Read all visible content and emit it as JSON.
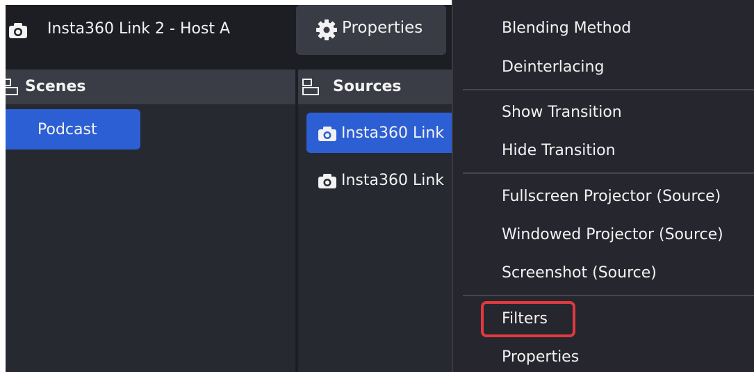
{
  "toolbar": {
    "source_title": "Insta360 Link 2 - Host A",
    "properties_label": "Properties"
  },
  "scenes": {
    "title": "Scenes",
    "items": [
      {
        "label": "Podcast",
        "selected": true
      }
    ]
  },
  "sources": {
    "title": "Sources",
    "items": [
      {
        "label": "Insta360 Link",
        "selected": true
      },
      {
        "label": "Insta360 Link",
        "selected": false
      }
    ]
  },
  "context_menu": {
    "items": [
      {
        "label": "Blending Method",
        "submenu": true
      },
      {
        "label": "Deinterlacing",
        "submenu": true
      },
      {
        "label": "Show Transition",
        "submenu": true
      },
      {
        "label": "Hide Transition",
        "submenu": true
      },
      {
        "label": "Fullscreen Projector (Source)",
        "submenu": true
      },
      {
        "label": "Windowed Projector (Source)",
        "submenu": false
      },
      {
        "label": "Screenshot (Source)",
        "submenu": false
      },
      {
        "label": "Filters",
        "submenu": false,
        "highlighted": true
      },
      {
        "label": "Properties",
        "submenu": false
      }
    ]
  },
  "colors": {
    "background": "#1d1e24",
    "dock": "#272930",
    "dock_header": "#3b3d46",
    "selection": "#2d5fd4",
    "highlight_box": "#e0393e"
  },
  "icons": [
    "camera-icon",
    "gear-icon",
    "scenes-dock-icon",
    "sources-dock-icon",
    "submenu-arrow-icon"
  ]
}
